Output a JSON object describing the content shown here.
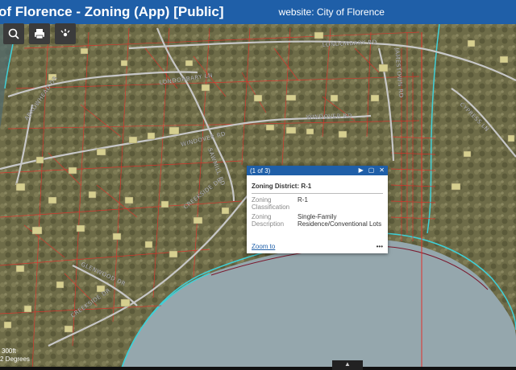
{
  "header": {
    "app_title": "of Florence - Zoning (App) [Public]",
    "website": "website: City of Florence"
  },
  "toolbar": {
    "buttons": [
      "search-icon",
      "print-icon",
      "locate-icon"
    ]
  },
  "map": {
    "road_labels": [
      "LONDONBARY RD",
      "LONDONBARY LN",
      "ARROWHEAD DR",
      "WINDOVER RD",
      "WINDOVER RD",
      "CREEKSIDE DR",
      "GLENWOOD DR",
      "CREEKSIDE DR",
      "CYPRESS LN",
      "SAWMILL RD",
      "JAMESTOWN RD"
    ],
    "scale_text": "300ft",
    "coord_text": "2 Degrees"
  },
  "popup": {
    "count": "(1 of 3)",
    "title": "Zoning District: R-1",
    "fields": [
      {
        "label": "Zoning Classification",
        "value": "R-1"
      },
      {
        "label": "Zoning Description",
        "value": "Single-Family Residence/Conventional Lots"
      }
    ],
    "zoom_label": "Zoom to",
    "more_label": "•••"
  },
  "colors": {
    "header_bg": "#1f5fa8",
    "parcel_line": "#e2302a",
    "water_outline": "#3fd0d8",
    "zone_line": "#7b1a2e"
  }
}
